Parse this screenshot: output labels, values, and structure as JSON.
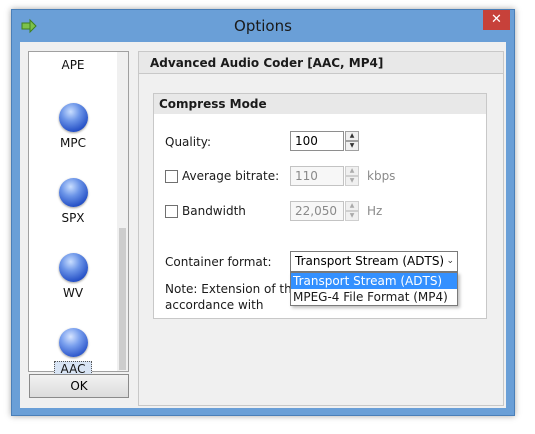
{
  "window": {
    "title": "Options",
    "close_glyph": "✕",
    "app_icon": "arrow-right-icon"
  },
  "formats": [
    {
      "label": "APE",
      "selected": false
    },
    {
      "label": "MPC",
      "selected": false
    },
    {
      "label": "SPX",
      "selected": false
    },
    {
      "label": "WV",
      "selected": false
    },
    {
      "label": "AAC",
      "selected": true
    }
  ],
  "ok_label": "OK",
  "panel": {
    "header": "Advanced Audio Coder [AAC, MP4]",
    "group_title": "Compress Mode",
    "quality": {
      "label": "Quality:",
      "value": "100"
    },
    "average_bitrate": {
      "label": "Average bitrate:",
      "value": "110",
      "unit": "kbps",
      "checked": false
    },
    "bandwidth": {
      "label": "Bandwidth",
      "value": "22,050",
      "unit": "Hz",
      "checked": false
    },
    "container": {
      "label": "Container format:",
      "selected": "Transport Stream (ADTS)",
      "options": [
        "Transport Stream (ADTS)",
        "MPEG-4 File Format (MP4)"
      ]
    },
    "note": "Note: Extension of the accordance with selecte"
  },
  "colors": {
    "titlebar": "#6a9fd7",
    "close": "#c7413a",
    "highlight": "#3390ff",
    "orb": "#2550c6"
  }
}
